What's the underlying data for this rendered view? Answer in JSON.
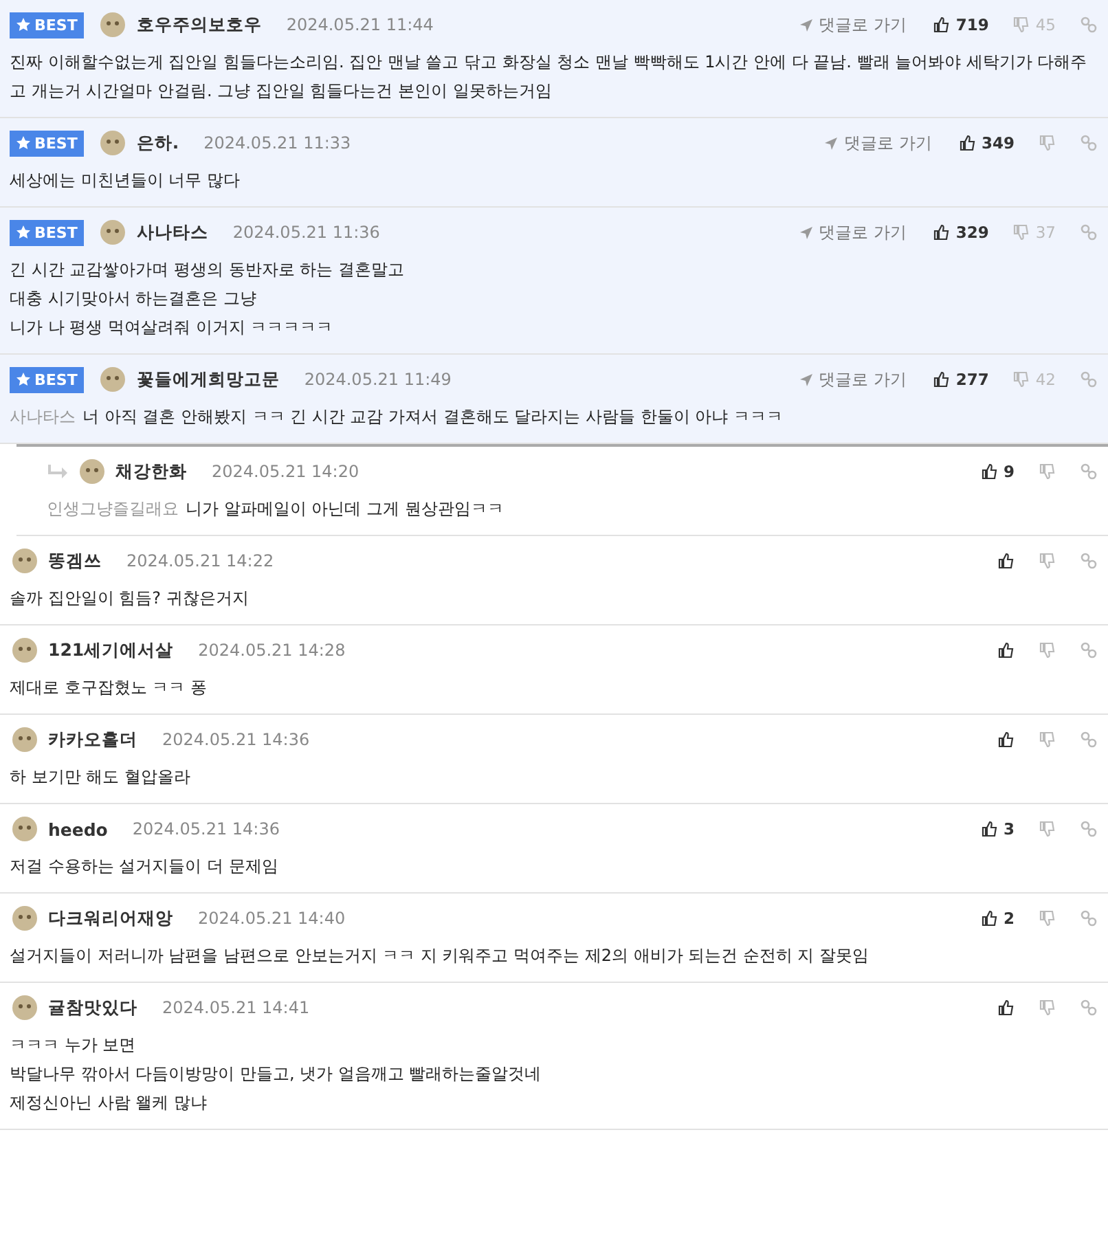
{
  "comments": [
    {
      "best": true,
      "reply": false,
      "badge": "BEST",
      "nick": "호우주의보호우",
      "date": "2024.05.21 11:44",
      "goto": "댓글로 가기",
      "likes": "719",
      "dislikes": "45",
      "lines": [
        "진짜 이해할수없는게 집안일 힘들다는소리임. 집안 맨날 쓸고 닦고 화장실 청소 맨날 빡빡해도 1시간 안에 다 끝남. 빨래 늘어봐야 세탁기가 다해주고 개는거 시간얼마 안걸림. 그냥 집안일 힘들다는건 본인이 일못하는거임"
      ]
    },
    {
      "best": true,
      "reply": false,
      "badge": "BEST",
      "nick": "은하.",
      "date": "2024.05.21 11:33",
      "goto": "댓글로 가기",
      "likes": "349",
      "lines": [
        "세상에는 미친년들이 너무 많다"
      ]
    },
    {
      "best": true,
      "reply": false,
      "badge": "BEST",
      "nick": "사나타스",
      "date": "2024.05.21 11:36",
      "goto": "댓글로 가기",
      "likes": "329",
      "dislikes": "37",
      "lines": [
        "긴 시간 교감쌓아가며 평생의 동반자로 하는 결혼말고",
        "대충 시기맞아서 하는결혼은 그냥",
        "니가 나 평생 먹여살려줘 이거지 ㅋㅋㅋㅋㅋ"
      ]
    },
    {
      "best": true,
      "reply": false,
      "badge": "BEST",
      "nick": "꽃들에게희망고문",
      "date": "2024.05.21 11:49",
      "goto": "댓글로 가기",
      "likes": "277",
      "dislikes": "42",
      "mention": "사나타스",
      "lines": [
        "너 아직 결혼 안해봤지 ㅋㅋ 긴 시간 교감 가져서 결혼해도 달라지는 사람들 한둘이 아냐 ㅋㅋㅋ"
      ]
    },
    {
      "best": false,
      "reply": true,
      "nick": "채강한화",
      "date": "2024.05.21 14:20",
      "likes": "9",
      "mention": "인생그냥즐길래요",
      "lines": [
        "니가 알파메일이 아닌데 그게 뭔상관임ㅋㅋ"
      ]
    },
    {
      "best": false,
      "reply": false,
      "nick": "똥겜쓰",
      "date": "2024.05.21 14:22",
      "lines": [
        "솔까 집안일이 힘듬? 귀찮은거지"
      ]
    },
    {
      "best": false,
      "reply": false,
      "nick": "121세기에서살",
      "date": "2024.05.21 14:28",
      "lines": [
        "제대로 호구잡혔노 ㅋㅋ 퐁"
      ]
    },
    {
      "best": false,
      "reply": false,
      "nick": "카카오홀더",
      "date": "2024.05.21 14:36",
      "lines": [
        "하 보기만 해도 혈압올라"
      ]
    },
    {
      "best": false,
      "reply": false,
      "nick": "heedo",
      "date": "2024.05.21 14:36",
      "likes": "3",
      "lines": [
        "저걸 수용하는 설거지들이 더 문제임"
      ]
    },
    {
      "best": false,
      "reply": false,
      "nick": "다크워리어재앙",
      "date": "2024.05.21 14:40",
      "likes": "2",
      "lines": [
        "설거지들이 저러니까 남편을 남편으로 안보는거지 ㅋㅋ 지 키워주고 먹여주는 제2의 애비가 되는건 순전히 지 잘못임"
      ]
    },
    {
      "best": false,
      "reply": false,
      "nick": "귤참맛있다",
      "date": "2024.05.21 14:41",
      "lines": [
        "ㅋㅋㅋ 누가 보면",
        "박달나무 깎아서 다듬이방망이 만들고, 냇가 얼음깨고 빨래하는줄알것네",
        "제정신아닌 사람 왤케 많냐"
      ]
    }
  ]
}
